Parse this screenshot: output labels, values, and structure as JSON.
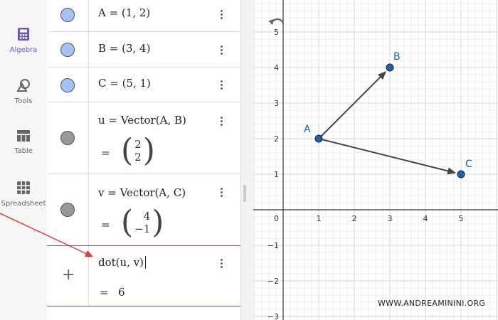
{
  "sidebar": {
    "items": [
      {
        "label": "Algebra",
        "icon": "calculator-icon"
      },
      {
        "label": "Tools",
        "icon": "shapes-icon"
      },
      {
        "label": "Table",
        "icon": "table-icon"
      },
      {
        "label": "Spreadsheet",
        "icon": "spreadsheet-icon"
      }
    ]
  },
  "algebra": {
    "rows": [
      {
        "expr": "A = (1, 2)",
        "color": "#a4c2f4"
      },
      {
        "expr": "B = (3, 4)",
        "color": "#a4c2f4"
      },
      {
        "expr": "C = (5, 1)",
        "color": "#a4c2f4"
      },
      {
        "expr": "u = Vector(A, B)",
        "equals": "=",
        "top": "2",
        "bottom": "2",
        "color": "#999999"
      },
      {
        "expr": "v = Vector(A, C)",
        "equals": "=",
        "top": "4",
        "bottom": "−1",
        "color": "#999999"
      }
    ],
    "input": {
      "text": "dot(u, v)",
      "equals": "=",
      "result": "6",
      "add_symbol": "+"
    }
  },
  "graph": {
    "undo_icon": "undo-icon",
    "x_ticks": [
      "1",
      "2",
      "3",
      "4",
      "5"
    ],
    "origin_label": "0",
    "y_ticks": [
      "5",
      "4",
      "3",
      "2",
      "1",
      "−1",
      "−2",
      "−3"
    ],
    "points": [
      {
        "name": "A",
        "x": 1,
        "y": 2
      },
      {
        "name": "B",
        "x": 3,
        "y": 4
      },
      {
        "name": "C",
        "x": 5,
        "y": 1
      }
    ],
    "vectors": [
      {
        "from": "A",
        "to": "B"
      },
      {
        "from": "A",
        "to": "C"
      }
    ],
    "point_color": "#1565c0",
    "vector_color": "#444444"
  },
  "watermark": "WWW.ANDREAMININI.ORG",
  "annotation_color": "#e53935"
}
